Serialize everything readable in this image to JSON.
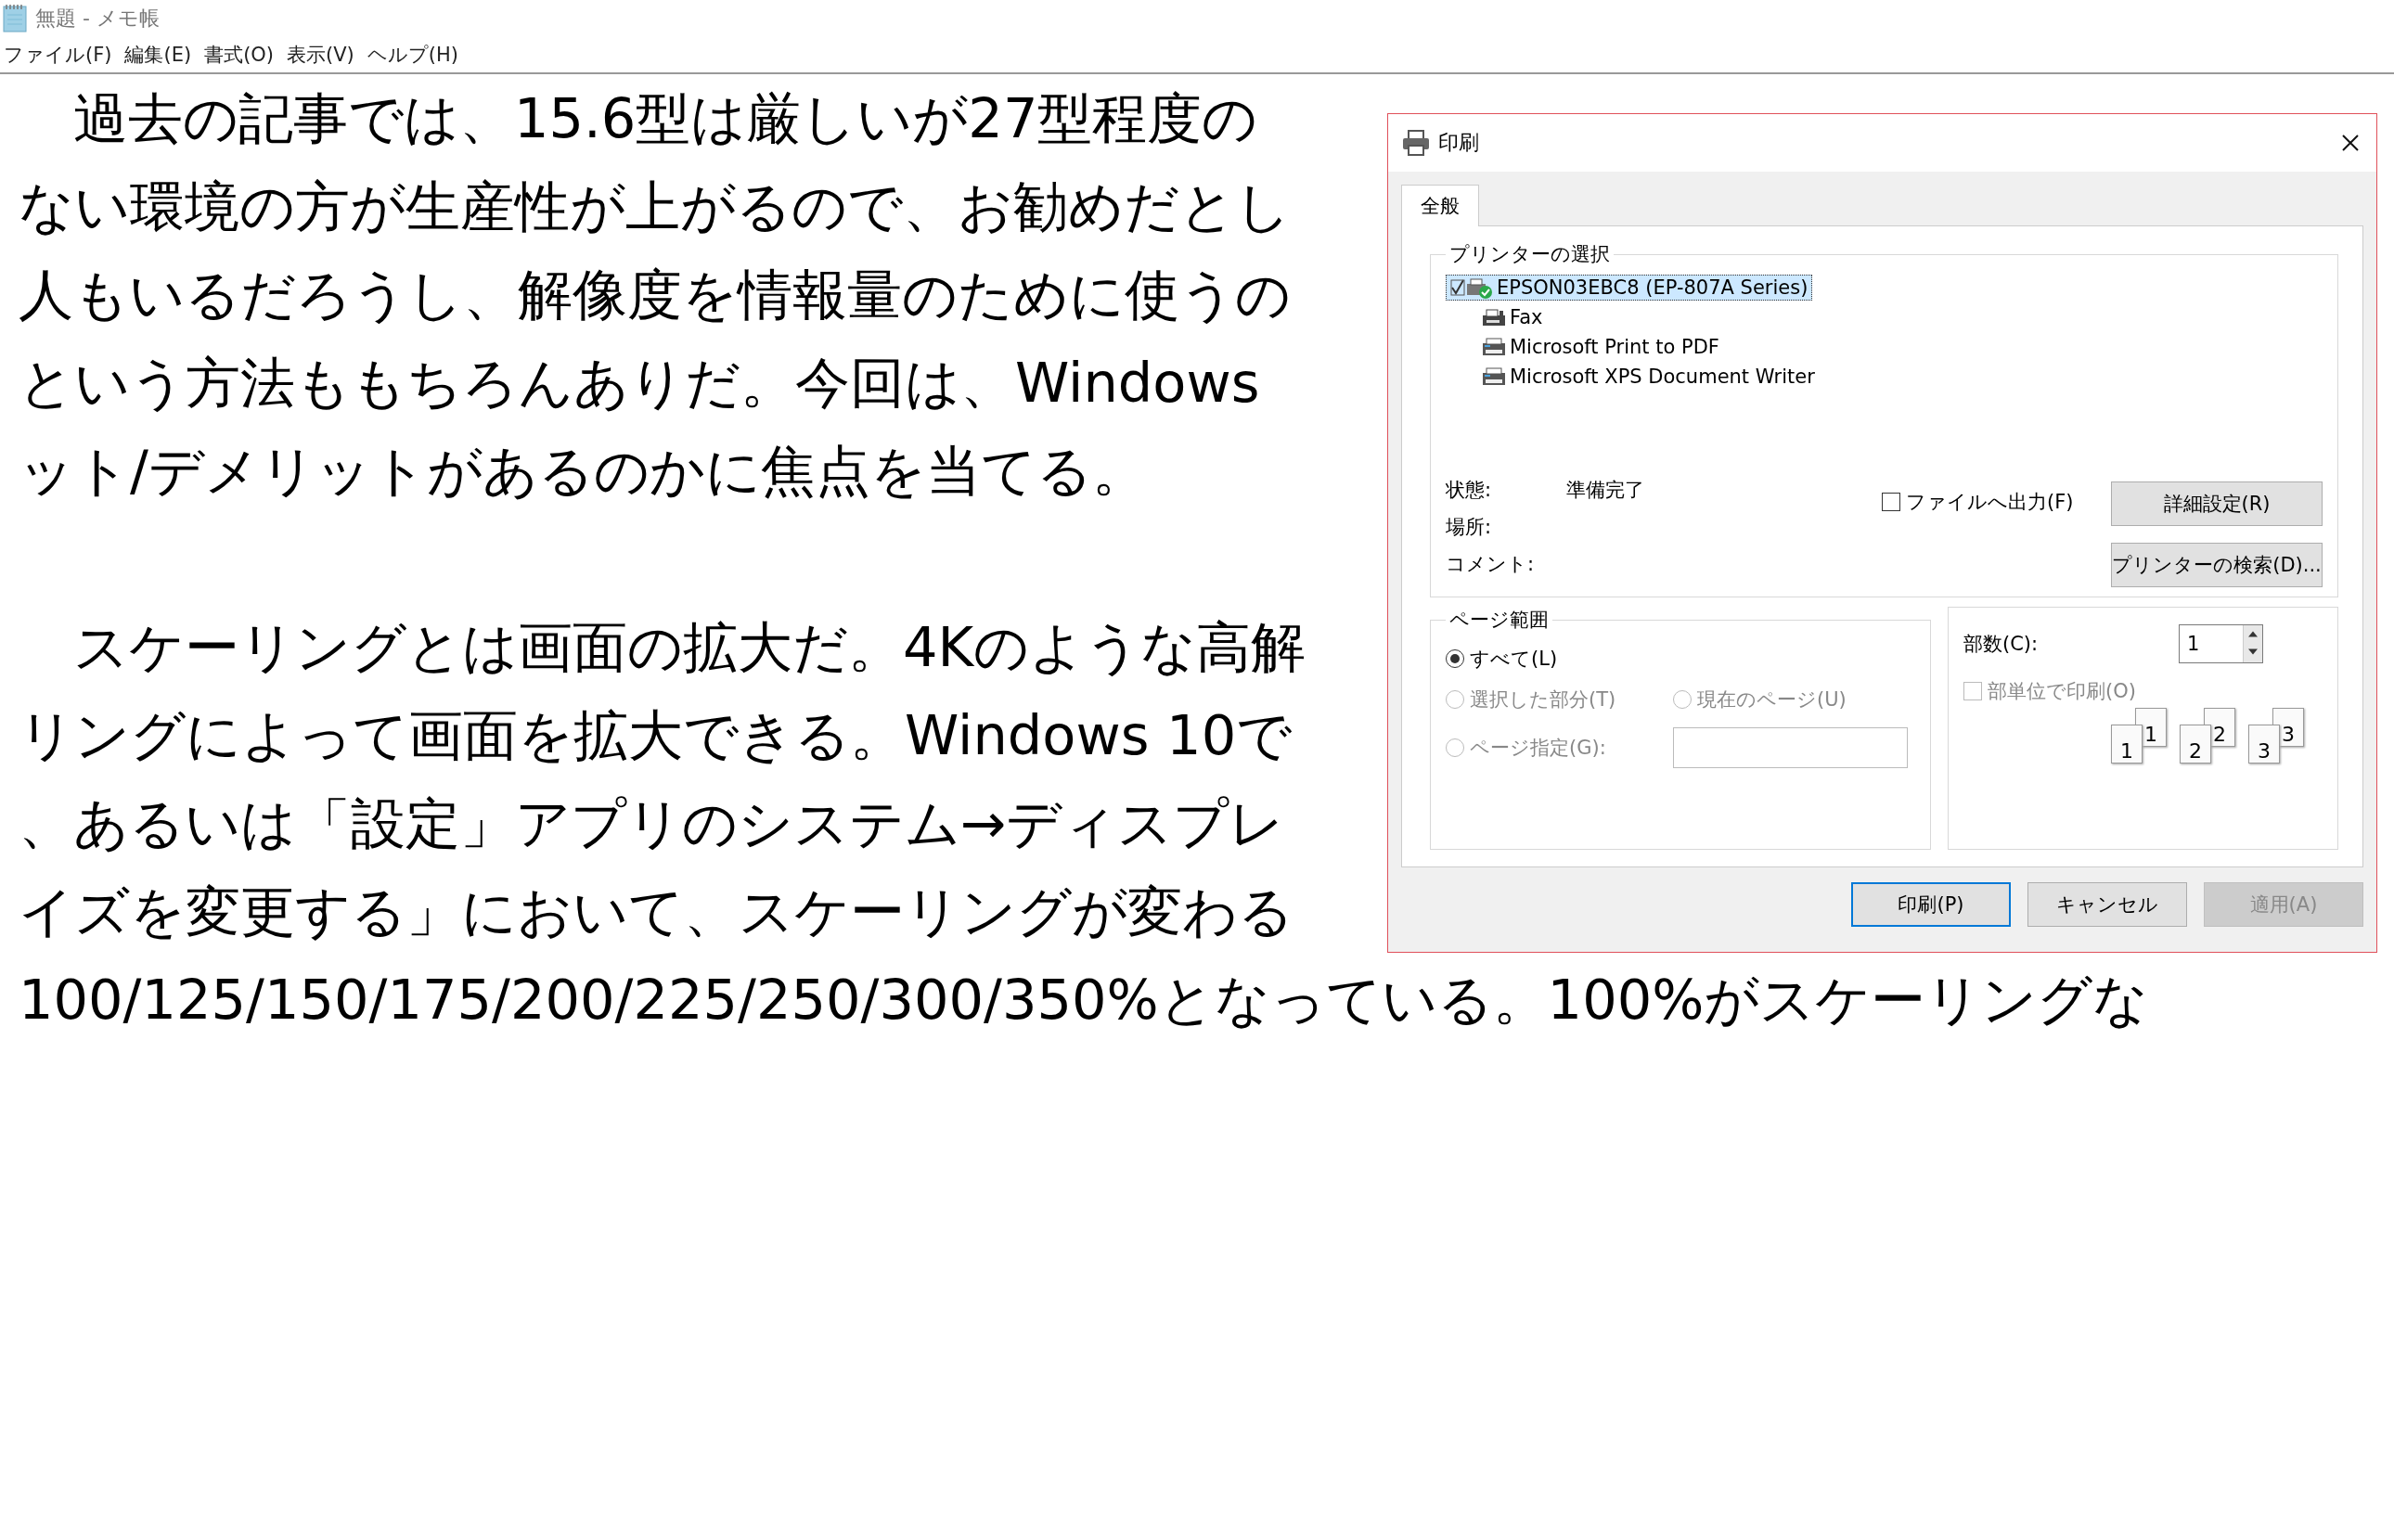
{
  "window": {
    "title": "無題 - メモ帳"
  },
  "menu": [
    "ファイル(F)",
    "編集(E)",
    "書式(O)",
    "表示(V)",
    "ヘルプ(H)"
  ],
  "document": {
    "paragraphs": [
      [
        "　過去の記事では、15.6型は厳しいが27型程度の",
        "ない環境の方が生産性が上がるので、お勧めだとし",
        "人もいるだろうし、解像度を情報量のために使うの",
        "という方法ももちろんありだ。今回は、Windows",
        "ット/デメリットがあるのかに焦点を当てる。"
      ],
      [
        "　スケーリングとは画面の拡大だ。4Kのような高解",
        "リングによって画面を拡大できる。Windows 10で",
        "、あるいは「設定」アプリのシステム→ディスプレ",
        "イズを変更する」において、スケーリングが変わる",
        "100/125/150/175/200/225/250/300/350%となっている。100%がスケーリングな"
      ]
    ]
  },
  "print_dialog": {
    "title": "印刷",
    "tabs": [
      {
        "label": "全般",
        "selected": true
      }
    ],
    "printer_group": {
      "title": "プリンターの選択",
      "printers": [
        {
          "name": "EPSON03EBC8 (EP-807A Series)",
          "kind": "default",
          "selected": true
        },
        {
          "name": "Fax",
          "kind": "fax",
          "selected": false
        },
        {
          "name": "Microsoft Print to PDF",
          "kind": "printer",
          "selected": false
        },
        {
          "name": "Microsoft XPS Document Writer",
          "kind": "printer",
          "selected": false
        }
      ]
    },
    "status": [
      {
        "label": "状態:",
        "value": "準備完了"
      },
      {
        "label": "場所:"
      },
      {
        "label": "コメント:"
      }
    ],
    "print_to_file": {
      "label": "ファイルへ出力(F)",
      "checked": false
    },
    "side_buttons": [
      "詳細設定(R)",
      "プリンターの検索(D)..."
    ],
    "page_range": {
      "title": "ページ範囲",
      "options": [
        {
          "label": "すべて(L)",
          "selected": true,
          "disabled": false
        },
        {
          "label": "選択した部分(T)",
          "selected": false,
          "disabled": true
        },
        {
          "label": "現在のページ(U)",
          "selected": false,
          "disabled": true
        },
        {
          "label": "ページ指定(G):",
          "selected": false,
          "disabled": true
        }
      ]
    },
    "copies": {
      "label": "部数(C):",
      "value": "1"
    },
    "collate": {
      "label": "部単位で印刷(O)",
      "checked": false,
      "disabled": true,
      "pages": [
        {
          "front": "1",
          "back": "1"
        },
        {
          "front": "2",
          "back": "2"
        },
        {
          "front": "3",
          "back": "3"
        }
      ]
    },
    "buttons": [
      {
        "label": "印刷(P)",
        "default": true,
        "disabled": false
      },
      {
        "label": "キャンセル",
        "default": false,
        "disabled": false
      },
      {
        "label": "適用(A)",
        "default": false,
        "disabled": true
      }
    ]
  }
}
